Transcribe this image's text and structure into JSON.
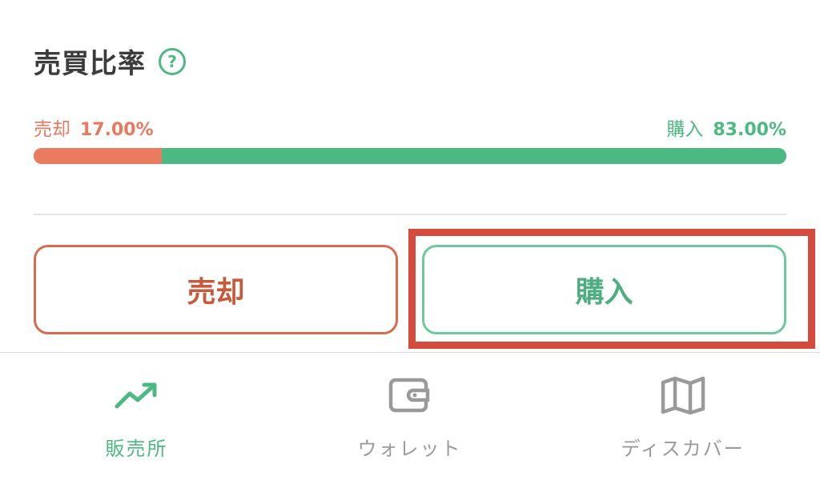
{
  "ratio": {
    "title": "売買比率",
    "help_icon": "question-circle-icon",
    "sell_label": "売却",
    "sell_percent_text": "17.00%",
    "sell_fraction": 0.17,
    "buy_label": "購入",
    "buy_percent_text": "83.00%",
    "buy_fraction": 0.83
  },
  "actions": {
    "sell_button": "売却",
    "buy_button": "購入"
  },
  "nav": {
    "items": [
      {
        "label": "販売所",
        "icon": "trending-up-icon",
        "active": true
      },
      {
        "label": "ウォレット",
        "icon": "wallet-icon",
        "active": false
      },
      {
        "label": "ディスカバー",
        "icon": "map-icon",
        "active": false
      }
    ]
  },
  "colors": {
    "sell": "#ea7b5e",
    "buy": "#4db982",
    "highlight": "#d44b3e"
  }
}
